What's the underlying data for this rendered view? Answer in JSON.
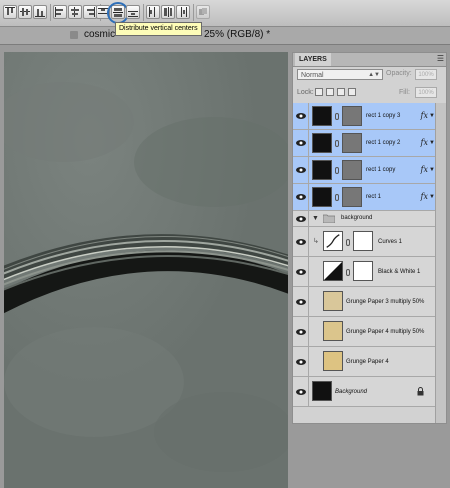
{
  "document": {
    "title": "cosmic",
    "mode": "25% (RGB/8) *"
  },
  "tooltip": "Distribute vertical centers",
  "layers_panel": {
    "tab_label": "LAYERS",
    "blend_mode": "Normal",
    "opacity_label": "Opacity:",
    "opacity_value": "100%",
    "lock_label": "Lock:",
    "fill_label": "Fill:",
    "fill_value": "100%",
    "group_name": "background",
    "layers": [
      {
        "name": "rect 1 copy 3",
        "fx": "fx"
      },
      {
        "name": "rect 1 copy 2",
        "fx": "fx"
      },
      {
        "name": "rect 1 copy",
        "fx": "fx"
      },
      {
        "name": "rect 1",
        "fx": "fx"
      },
      {
        "name": "Curves 1"
      },
      {
        "name": "Black & White 1"
      },
      {
        "name": "Grunge Paper 3 multiply 50%"
      },
      {
        "name": "Grunge Paper 4 multiply 50%"
      },
      {
        "name": "Grunge Paper 4"
      },
      {
        "name": "Background"
      }
    ]
  },
  "colors": {
    "selection": "#a8c8f8",
    "tooltip_bg": "#fdfcb8",
    "highlight_ring": "#2e6fb8"
  }
}
